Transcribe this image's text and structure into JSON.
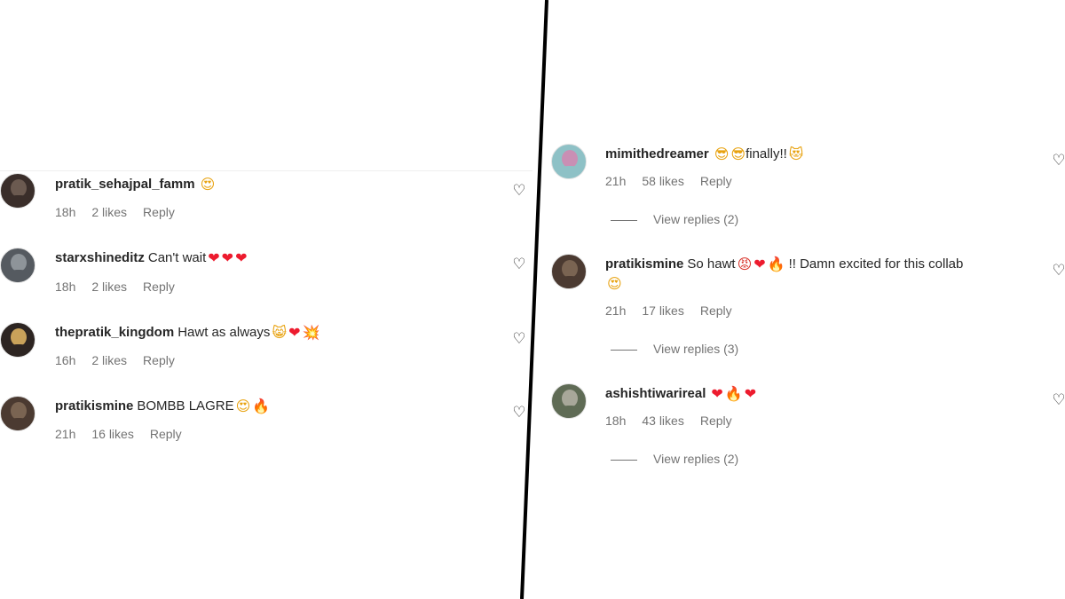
{
  "left_comments": [
    {
      "username": "pratik_sehajpal_famm",
      "text": "",
      "emoji": [
        {
          "ch": "😍",
          "cls": "e-face"
        }
      ],
      "time": "18h",
      "likes": "2 likes",
      "reply": "Reply",
      "avatar_colors": [
        "#3a2e2a",
        "#6b5a50"
      ]
    },
    {
      "username": "starxshineditz",
      "text": "Can't wait",
      "emoji": [
        {
          "ch": "❤",
          "cls": "e-heart"
        },
        {
          "ch": "❤",
          "cls": "e-heart"
        },
        {
          "ch": "❤",
          "cls": "e-heart"
        }
      ],
      "time": "18h",
      "likes": "2 likes",
      "reply": "Reply",
      "avatar_colors": [
        "#555a60",
        "#8e9499"
      ]
    },
    {
      "username": "thepratik_kingdom",
      "text": "Hawt as always",
      "emoji": [
        {
          "ch": "😸",
          "cls": "e-face"
        },
        {
          "ch": "❤",
          "cls": "e-heart"
        },
        {
          "ch": "💥",
          "cls": "e-boom"
        }
      ],
      "time": "16h",
      "likes": "2 likes",
      "reply": "Reply",
      "avatar_colors": [
        "#2d2522",
        "#c9a25a"
      ]
    },
    {
      "username": "pratikismine",
      "text": "BOMBB LAGRE",
      "emoji": [
        {
          "ch": "😍",
          "cls": "e-face"
        },
        {
          "ch": "🔥",
          "cls": "e-fire"
        }
      ],
      "time": "21h",
      "likes": "16 likes",
      "reply": "Reply",
      "avatar_colors": [
        "#4b3a31",
        "#7a6452"
      ]
    }
  ],
  "right_comments": [
    {
      "username": "mimithedreamer",
      "text": "",
      "emoji": [
        {
          "ch": "😎",
          "cls": "e-face"
        },
        {
          "ch": "😎",
          "cls": "e-face"
        }
      ],
      "text_after": "finally!!",
      "emoji_after": [
        {
          "ch": "😻",
          "cls": "e-face"
        }
      ],
      "time": "21h",
      "likes": "58 likes",
      "reply": "Reply",
      "view_replies": "View replies (2)",
      "avatar_colors": [
        "#8ec1c6",
        "#c98fb4"
      ]
    },
    {
      "username": "pratikismine",
      "text": "So hawt",
      "emoji": [
        {
          "ch": "😡",
          "cls": "e-angry"
        },
        {
          "ch": "❤",
          "cls": "e-heart"
        },
        {
          "ch": "🔥",
          "cls": "e-fire"
        }
      ],
      "text_after": "!! Damn excited for this collab",
      "emoji_line2": [
        {
          "ch": "😍",
          "cls": "e-face"
        }
      ],
      "time": "21h",
      "likes": "17 likes",
      "reply": "Reply",
      "view_replies": "View replies (3)",
      "avatar_colors": [
        "#4b3a31",
        "#7a6452"
      ]
    },
    {
      "username": "ashishtiwarireal",
      "text": "",
      "emoji": [
        {
          "ch": "❤",
          "cls": "e-heart"
        },
        {
          "ch": "🔥",
          "cls": "e-fire"
        },
        {
          "ch": "❤",
          "cls": "e-heart"
        }
      ],
      "time": "18h",
      "likes": "43 likes",
      "reply": "Reply",
      "view_replies": "View replies (2)",
      "avatar_colors": [
        "#5f6b55",
        "#a8a79a"
      ]
    }
  ],
  "icons": {
    "like": "heart-outline-icon",
    "like_glyph": "♡"
  }
}
